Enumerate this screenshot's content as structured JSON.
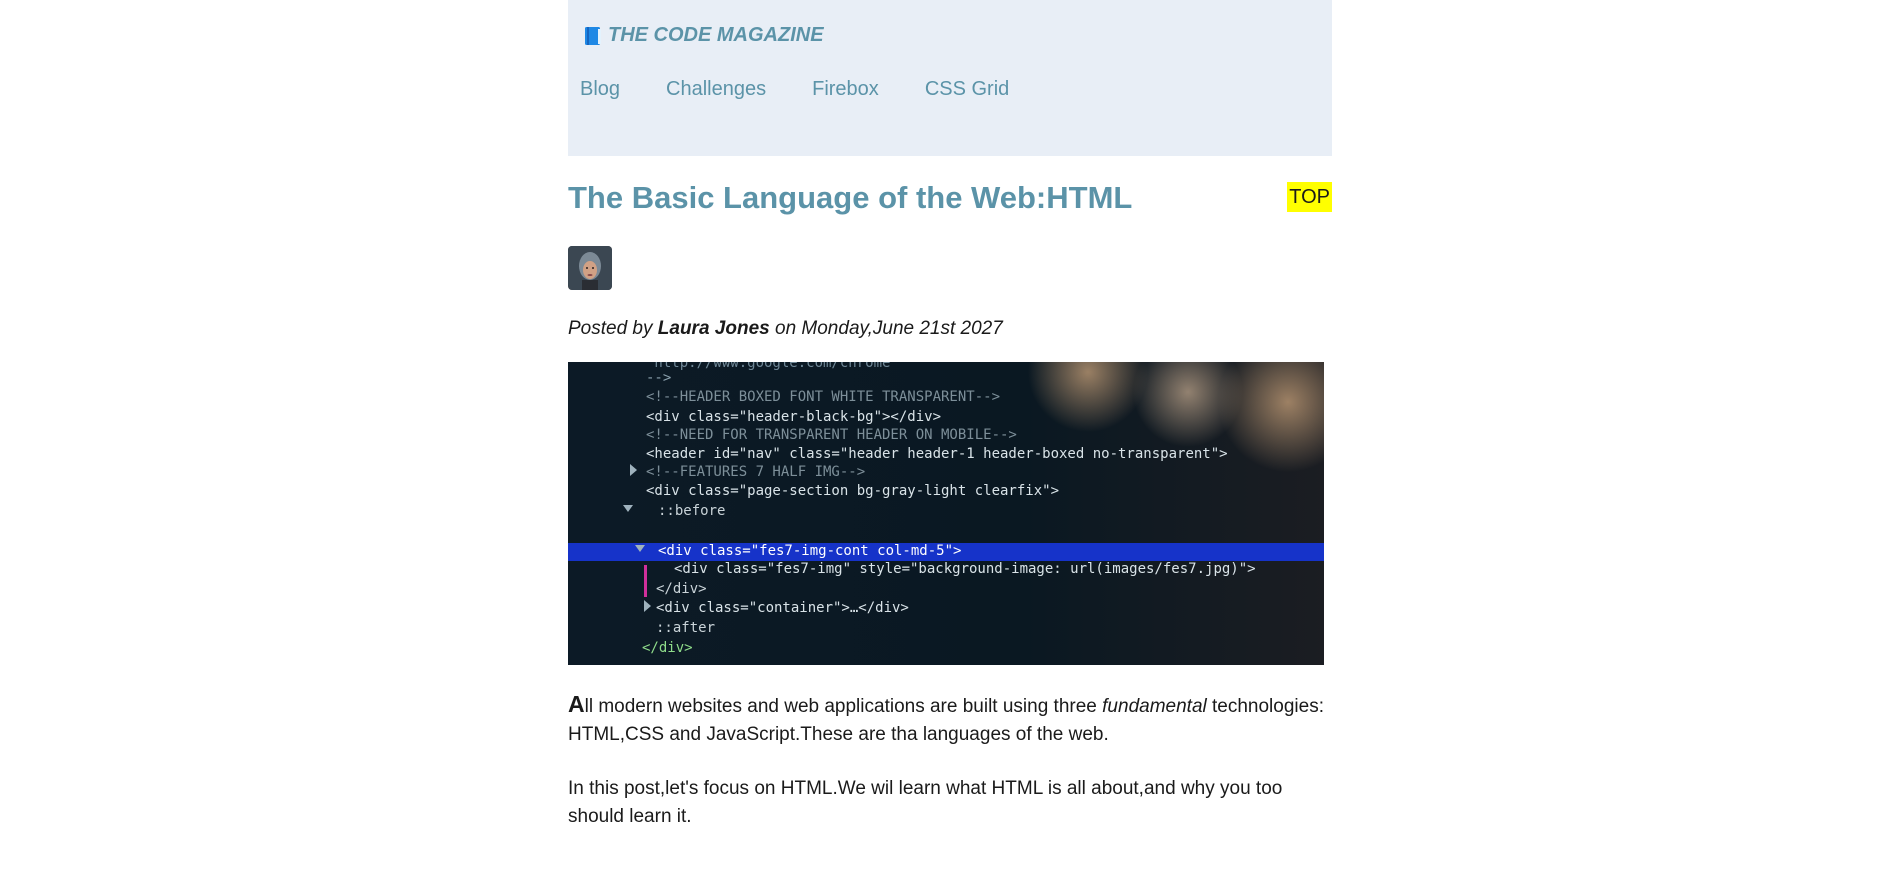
{
  "brand": {
    "icon": "book-icon",
    "title": "THE CODE MAGAZINE"
  },
  "nav": {
    "items": [
      {
        "label": "Blog"
      },
      {
        "label": "Challenges"
      },
      {
        "label": "Firebox"
      },
      {
        "label": "CSS Grid"
      }
    ]
  },
  "top_link": "TOP",
  "post": {
    "title": "The Basic Language of the Web:HTML",
    "byline_prefix": "Posted by",
    "author": "Laura Jones",
    "byline_date": "on Monday,June 21st 2027",
    "hero_code_lines": [
      "\"http://www.google.com/chrome\"",
      "-->",
      "<!--HEADER BOXED FONT WHITE TRANSPARENT-->",
      "<div class=\"header-black-bg\"></div>",
      "<!--NEED FOR TRANSPARENT HEADER ON MOBILE-->",
      "<header id=\"nav\" class=\"header header-1 header-boxed no-transparent\">",
      "<!--FEATURES 7 HALF IMG-->",
      "<div class=\"page-section bg-gray-light clearfix\">",
      "::before",
      "<div class=\"fes7-img-cont col-md-5\">",
      "<div class=\"fes7-img\" style=\"background-image: url(images/fes7.jpg)\">",
      "</div>",
      "<div class=\"container\">…</div>",
      "::after",
      "</div>"
    ],
    "para1_dropcap": "A",
    "para1_text_a": "ll modern websites and web applications are built using three ",
    "para1_em": "fundamental",
    "para1_text_b": " technologies:",
    "para1_line2": "HTML,CSS and JavaScript.These are tha languages of the web.",
    "para2": "In this post,let's focus on HTML.We wil learn what HTML is all about,and why you too should learn it."
  },
  "colors": {
    "accent": "#5b93a8",
    "header_bg": "#e8eef6",
    "top_highlight": "#ffff00"
  }
}
